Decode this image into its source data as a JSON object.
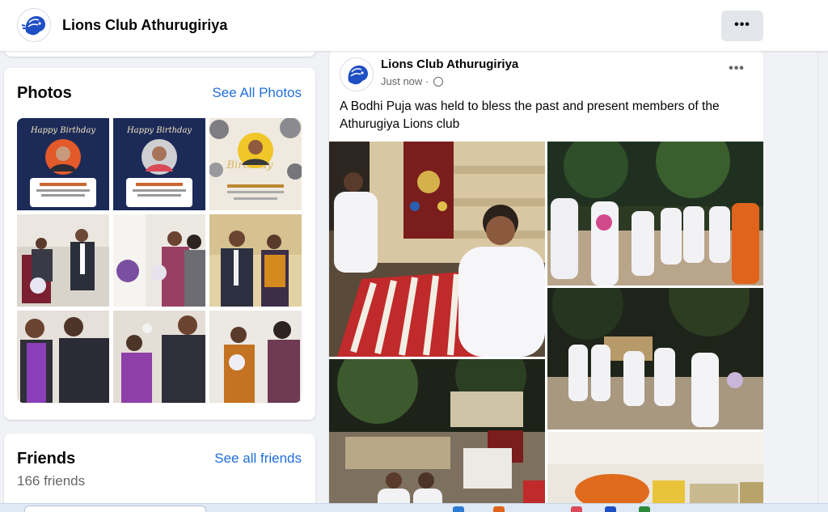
{
  "header": {
    "page_name": "Lions Club Athurugiriya",
    "more_label": "•••"
  },
  "photos_card": {
    "title": "Photos",
    "link": "See All Photos",
    "photos": [
      {
        "kind": "birthday",
        "headline": "Happy Birthday"
      },
      {
        "kind": "birthday",
        "headline": "Happy Birthday"
      },
      {
        "kind": "birthday-balloons",
        "headline": "Birthday"
      },
      {
        "kind": "people"
      },
      {
        "kind": "people"
      },
      {
        "kind": "people"
      },
      {
        "kind": "people"
      },
      {
        "kind": "people"
      },
      {
        "kind": "people"
      }
    ]
  },
  "friends_card": {
    "title": "Friends",
    "link": "See all friends",
    "count": "166 friends"
  },
  "post": {
    "author": "Lions Club Athurugiriya",
    "time": "Just now ·",
    "more_label": "•••",
    "text": "A Bodhi Puja was held to bless the past and present members of the Athurugiya Lions club",
    "media_count": 6
  },
  "colors": {
    "link": "#216fdb",
    "page_bg": "#f0f2f5",
    "card_bg": "#ffffff",
    "muted": "#65676b"
  }
}
